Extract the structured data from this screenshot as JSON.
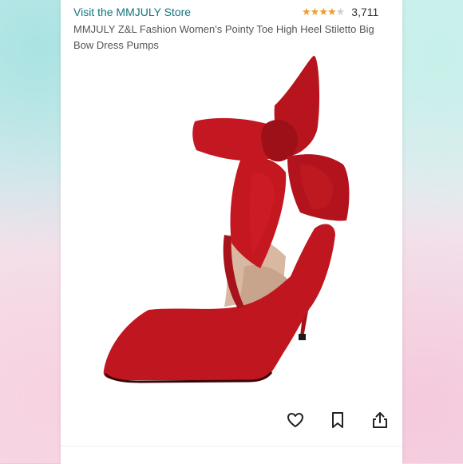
{
  "store": {
    "link_text": "Visit the MMJULY Store"
  },
  "rating": {
    "stars_filled": 4,
    "stars_total": 5,
    "review_count": "3,711",
    "star_color": "#ef9c2b"
  },
  "product": {
    "title": "MMJULY Z&L Fashion Women's Pointy Toe High Heel Stiletto Big Bow Dress Pumps",
    "shoe_color": "#c0161f"
  },
  "actions": [
    {
      "icon": "heart-icon"
    },
    {
      "icon": "bookmark-icon"
    },
    {
      "icon": "share-icon"
    }
  ],
  "colors": {
    "link": "#14757f",
    "text": "#555555"
  }
}
